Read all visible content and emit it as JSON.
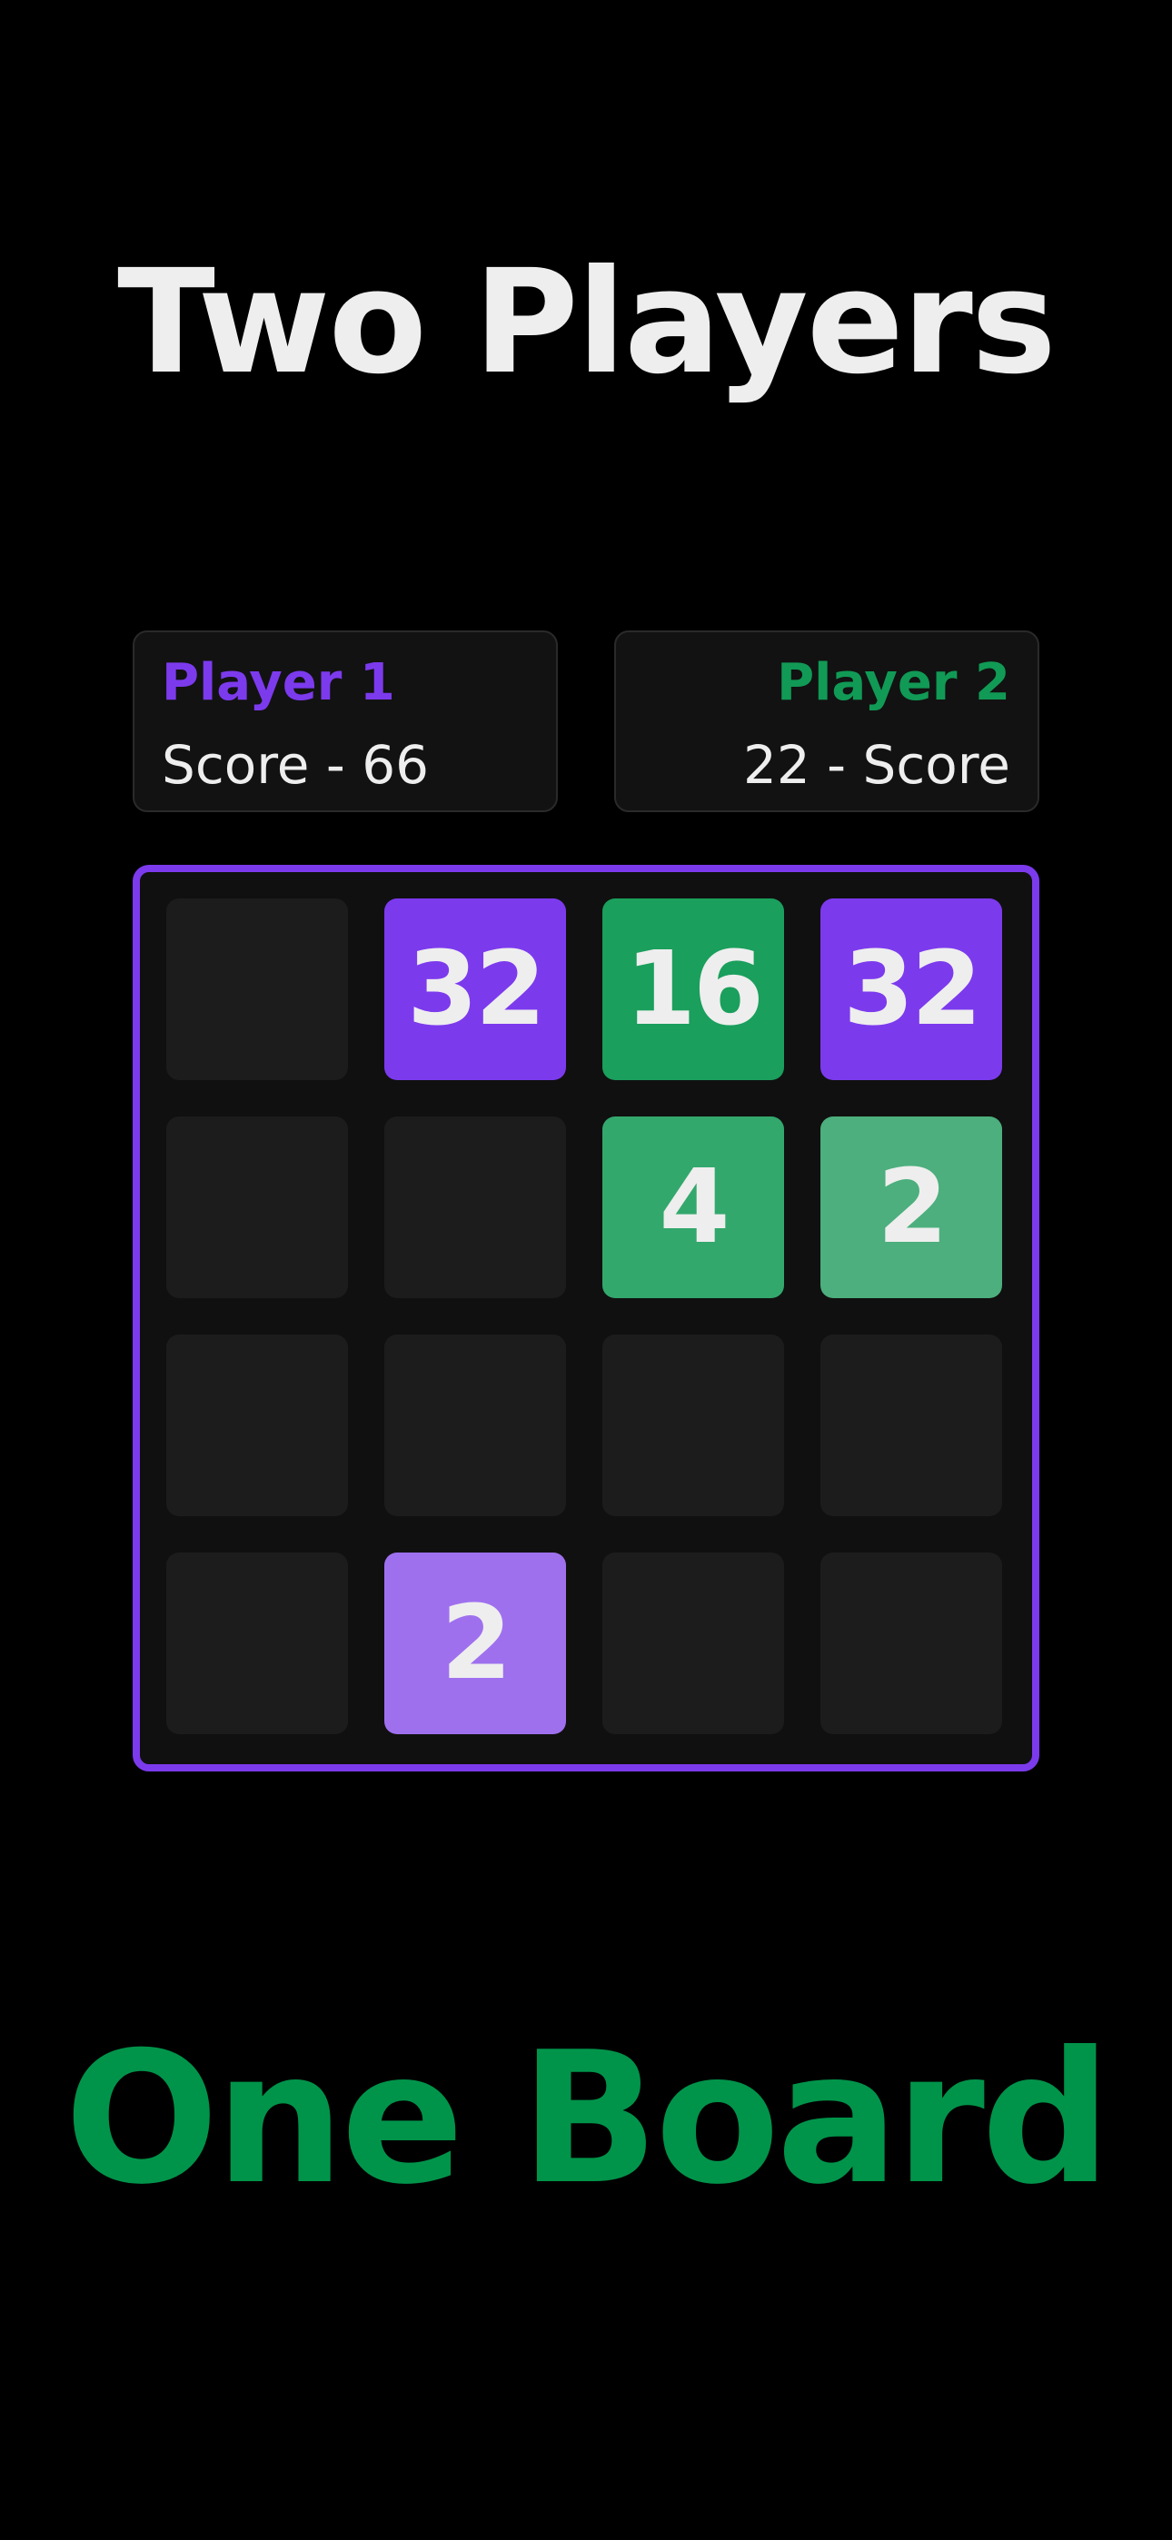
{
  "header": {
    "title": "Two Players"
  },
  "players": [
    {
      "name": "Player 1",
      "score_line": "Score - 66",
      "score": 66,
      "color": "#7c3aed"
    },
    {
      "name": "Player 2",
      "score_line": "22 - Score",
      "score": 22,
      "color": "#119a55"
    }
  ],
  "board": {
    "border_color": "#7c3aed",
    "empty_color": "#1c1c1c",
    "rows": [
      [
        {
          "value": ""
        },
        {
          "value": "32",
          "color": "#7c3aed"
        },
        {
          "value": "16",
          "color": "#1a9f5c"
        },
        {
          "value": "32",
          "color": "#7c3aed"
        }
      ],
      [
        {
          "value": ""
        },
        {
          "value": ""
        },
        {
          "value": "4",
          "color": "#33a86c"
        },
        {
          "value": "2",
          "color": "#4caf7d"
        }
      ],
      [
        {
          "value": ""
        },
        {
          "value": ""
        },
        {
          "value": ""
        },
        {
          "value": ""
        }
      ],
      [
        {
          "value": ""
        },
        {
          "value": "2",
          "color": "#9f70ee"
        },
        {
          "value": ""
        },
        {
          "value": ""
        }
      ]
    ]
  },
  "footer": {
    "tagline": "One Board"
  }
}
